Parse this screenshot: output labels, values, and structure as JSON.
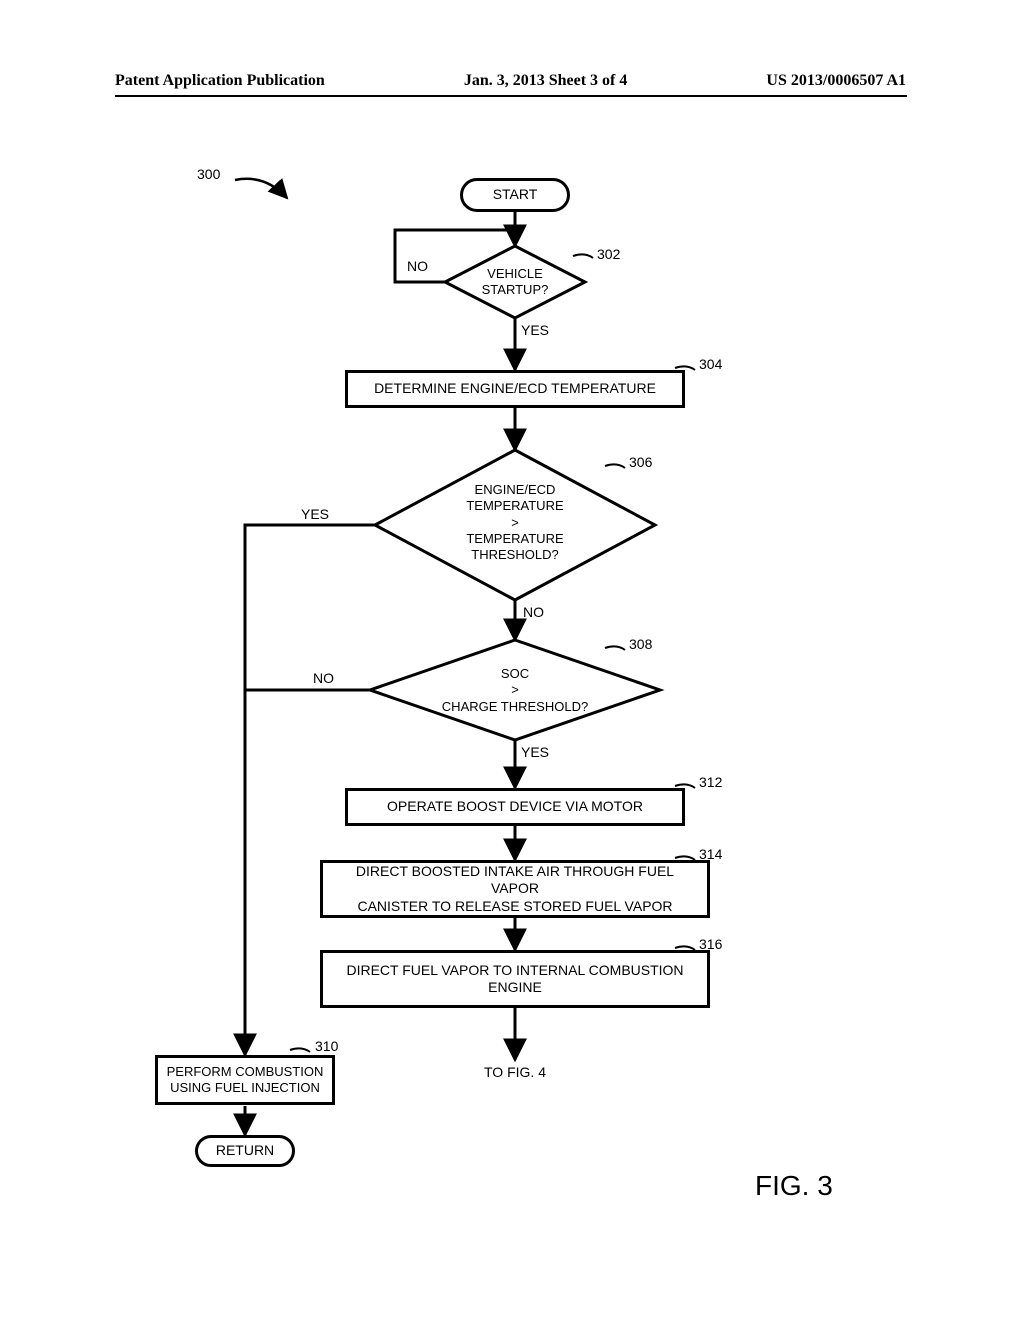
{
  "header": {
    "left": "Patent Application Publication",
    "mid": "Jan. 3, 2013  Sheet 3 of 4",
    "right": "US 2013/0006507 A1"
  },
  "refs": {
    "fig_num": "300",
    "r302": "302",
    "r304": "304",
    "r306": "306",
    "r308": "308",
    "r310": "310",
    "r312": "312",
    "r314": "314",
    "r316": "316"
  },
  "nodes": {
    "start": "START",
    "dec_startup": "VEHICLE\nSTARTUP?",
    "proc_temp": "DETERMINE ENGINE/ECD TEMPERATURE",
    "dec_temp": "ENGINE/ECD\nTEMPERATURE\n>\nTEMPERATURE\nTHRESHOLD?",
    "dec_soc": "SOC\n>\nCHARGE THRESHOLD?",
    "proc_boost": "OPERATE BOOST DEVICE VIA MOTOR",
    "proc_canister": "DIRECT BOOSTED INTAKE AIR THROUGH FUEL VAPOR\nCANISTER TO RELEASE STORED FUEL VAPOR",
    "proc_direct": "DIRECT FUEL VAPOR TO INTERNAL COMBUSTION\nENGINE",
    "proc_inject": "PERFORM COMBUSTION\nUSING FUEL INJECTION",
    "to_fig4": "TO FIG. 4",
    "return": "RETURN"
  },
  "labels": {
    "yes": "YES",
    "no": "NO"
  },
  "figure": {
    "label": "FIG. 3"
  }
}
